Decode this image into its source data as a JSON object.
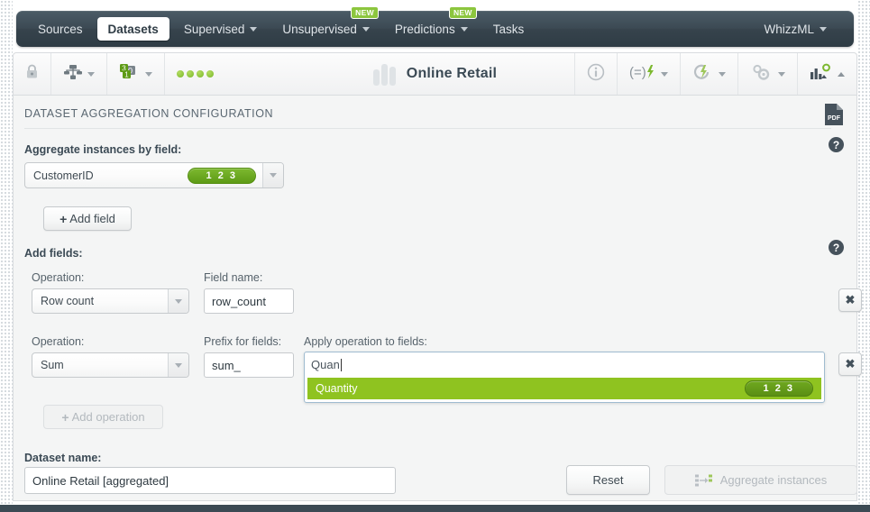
{
  "nav": {
    "items": [
      {
        "label": "Sources",
        "caret": false,
        "active": false,
        "badge": null
      },
      {
        "label": "Datasets",
        "caret": false,
        "active": true,
        "badge": null
      },
      {
        "label": "Supervised",
        "caret": true,
        "active": false,
        "badge": null
      },
      {
        "label": "Unsupervised",
        "caret": true,
        "active": false,
        "badge": "NEW"
      },
      {
        "label": "Predictions",
        "caret": true,
        "active": false,
        "badge": "NEW"
      },
      {
        "label": "Tasks",
        "caret": false,
        "active": false,
        "badge": null
      }
    ],
    "account": {
      "label": "WhizzML",
      "caret": true
    }
  },
  "toolbar": {
    "lock_icon": "lock-icon",
    "sharing_icon": "network-share-icon",
    "fields_icon": "field-types-icon",
    "status_dots": 4,
    "resource_title": "Online Retail",
    "right_icons": [
      "chart-configure-icon",
      "gears-icon",
      "one-click-model-icon",
      "script-icon",
      "info-icon"
    ]
  },
  "panel": {
    "section_title": "DATASET AGGREGATION CONFIGURATION",
    "export_icon_label": "PDF",
    "help_icon_label": "?",
    "aggregate_by": {
      "label": "Aggregate instances by field:",
      "value": "CustomerID",
      "type_badge": "1 2 3",
      "add_field_button": "Add field"
    },
    "add_fields": {
      "label": "Add fields:",
      "rows": [
        {
          "operation_label": "Operation:",
          "operation_value": "Row count",
          "second_label": "Field name:",
          "second_value": "row_count",
          "remove_label": "✖"
        },
        {
          "operation_label": "Operation:",
          "operation_value": "Sum",
          "second_label": "Prefix for fields:",
          "second_value": "sum_",
          "remove_label": "✖"
        }
      ],
      "apply_to_fields": {
        "label": "Apply operation to fields:",
        "input_value": "Quan",
        "suggestions": [
          {
            "name": "Quantity",
            "type_badge": "1 2 3"
          }
        ]
      },
      "add_operation_button": "Add operation",
      "add_operation_disabled": true
    },
    "dataset_name": {
      "label": "Dataset name:",
      "value": "Online Retail [aggregated]"
    },
    "actions": {
      "reset": "Reset",
      "submit": "Aggregate instances",
      "submit_disabled": true
    }
  },
  "colors": {
    "nav_dark": "#3c4a54",
    "accent_green": "#8fc320",
    "badge_green": "#6aa818",
    "panel_bg": "#f4f5f5"
  }
}
